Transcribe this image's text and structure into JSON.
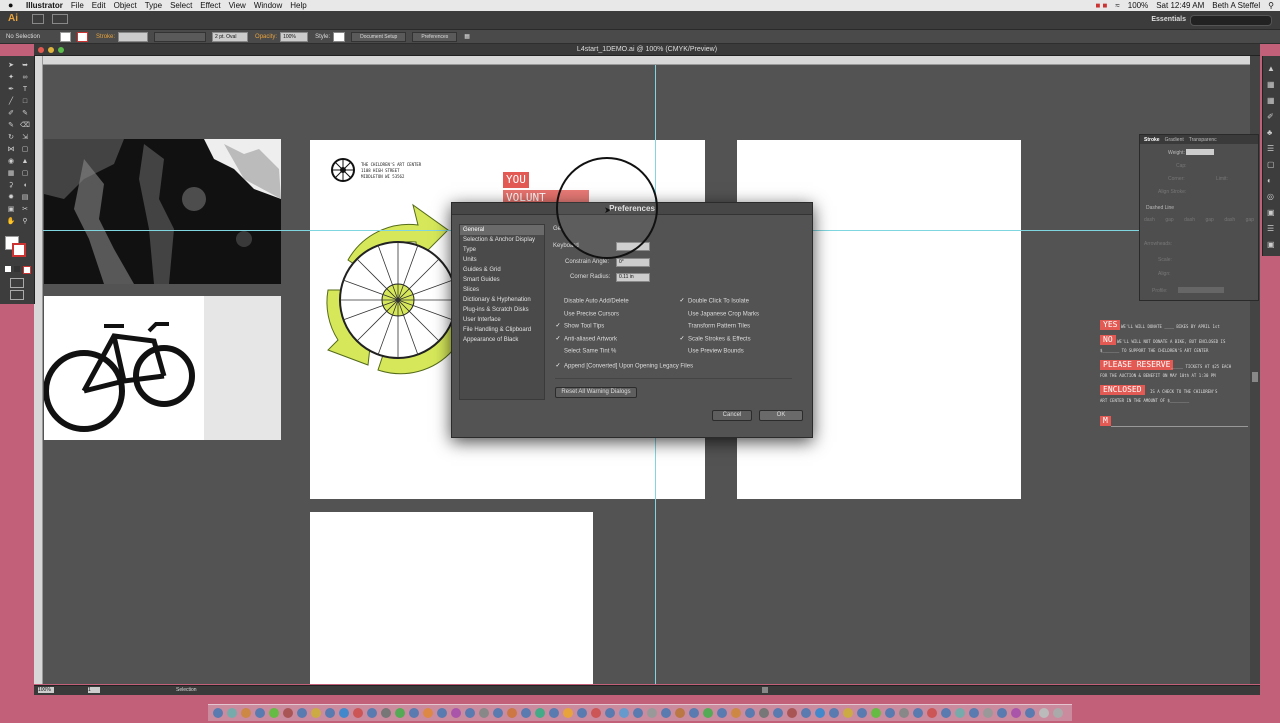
{
  "menubar": {
    "app": "Illustrator",
    "items": [
      "File",
      "Edit",
      "Object",
      "Type",
      "Select",
      "Effect",
      "View",
      "Window",
      "Help"
    ],
    "battery": "100%",
    "clock": "Sat 12:49 AM",
    "user": "Beth A Steffel"
  },
  "appbar": {
    "logo": "Ai",
    "workspace": "Essentials"
  },
  "controlbar": {
    "selection": "No Selection",
    "stroke_label": "Stroke:",
    "brush": "2 pt. Oval",
    "opacity_label": "Opacity:",
    "opacity": "100%",
    "style_label": "Style:",
    "document_setup": "Document Setup",
    "preferences": "Preferences"
  },
  "document": {
    "title": "L4start_1DEMO.ai @ 100% (CMYK/Preview)"
  },
  "stroke_panel": {
    "tabs": [
      "Stroke",
      "Gradient",
      "Transparenc"
    ],
    "weight_label": "Weight:",
    "cap_label": "Cap:",
    "corner_label": "Corner:",
    "limit_label": "Limit:",
    "align_label": "Align Stroke:",
    "dashed_label": "Dashed Line",
    "dash_cols": [
      "dash",
      "gap",
      "dash",
      "gap",
      "dash",
      "gap"
    ],
    "arrowheads_label": "Arrowheads:",
    "scale_label": "Scale:",
    "align2_label": "Align:",
    "profile_label": "Profile:"
  },
  "artwork": {
    "org_lines": [
      "THE CHILDREN'S ART CENTER",
      "1108 HIGH STREET",
      "MIDDLETON WI 53562"
    ],
    "you": "YOU",
    "volunteers_partial": "VOLUNT"
  },
  "response": {
    "yes": "YES",
    "yes_text": "WE'LL WILL DONATE ____ BIKES BY APRIL 1st",
    "no": "NO",
    "no_text_1": "WE'LL WILL NOT DONATE A BIKE, BUT ENCLOSED IS",
    "no_text_2": "$_______ TO SUPPORT THE CHILDREN'S ART CENTER",
    "reserve": "PLEASE RESERVE",
    "reserve_text_1": "_____ TICKETS AT $25 EACH",
    "reserve_text_2": "FOR THE AUCTION & BENEFIT ON MAY 10th AT 1:30 PM",
    "enclosed": "ENCLOSED",
    "enclosed_text_1": "IS A CHECK TO THE CHILDREN'S",
    "enclosed_text_2": "ART CENTER IN THE AMOUNT OF $________",
    "m": "M"
  },
  "dialog": {
    "title": "Preferences",
    "categories": [
      "General",
      "Selection & Anchor Display",
      "Type",
      "Units",
      "Guides & Grid",
      "Smart Guides",
      "Slices",
      "Dictionary & Hyphenation",
      "Plug-ins & Scratch Disks",
      "User Interface",
      "File Handling & Clipboard",
      "Appearance of Black"
    ],
    "header_partial": "Ge",
    "keyboard_label": "Keyboard",
    "constrain_label": "Constrain Angle:",
    "constrain_value": "0°",
    "corner_label": "Corner Radius:",
    "corner_value": "0.11 in",
    "options_left": [
      {
        "label": "Disable Auto Add/Delete",
        "checked": false
      },
      {
        "label": "Use Precise Cursors",
        "checked": false
      },
      {
        "label": "Show Tool Tips",
        "checked": true
      },
      {
        "label": "Anti-aliased Artwork",
        "checked": true
      },
      {
        "label": "Select Same Tint %",
        "checked": false
      }
    ],
    "options_right": [
      {
        "label": "Double Click To Isolate",
        "checked": true
      },
      {
        "label": "Use Japanese Crop Marks",
        "checked": false
      },
      {
        "label": "Transform Pattern Tiles",
        "checked": false
      },
      {
        "label": "Scale Strokes & Effects",
        "checked": true
      },
      {
        "label": "Use Preview Bounds",
        "checked": false
      }
    ],
    "append_label": "Append [Converted] Upon Opening Legacy Files",
    "append_checked": true,
    "reset_label": "Reset All Warning Dialogs",
    "cancel_label": "Cancel",
    "ok_label": "OK"
  },
  "statusbar": {
    "zoom": "100%",
    "page": "1",
    "mode": "Selection"
  }
}
